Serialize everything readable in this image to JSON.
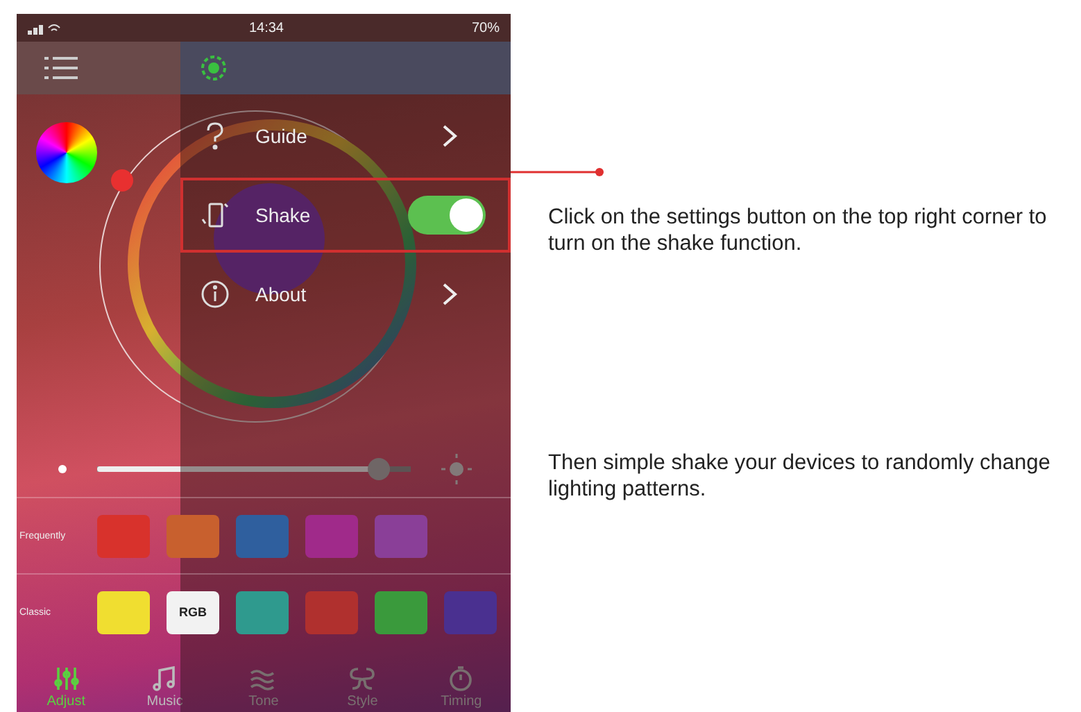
{
  "status_bar": {
    "time": "14:34",
    "battery": "70%"
  },
  "menu": [
    {
      "kind": "link",
      "label": "Guide",
      "highlighted": false
    },
    {
      "kind": "toggle",
      "label": "Shake",
      "on": true,
      "highlighted": true
    },
    {
      "kind": "link",
      "label": "About",
      "highlighted": false
    }
  ],
  "brightness": {
    "level": 0.9
  },
  "presets": [
    {
      "label": "Frequently",
      "swatches": [
        {
          "color": "#d8322c"
        },
        {
          "color": "#c8602e"
        },
        {
          "color": "#2f5f9e"
        },
        {
          "color": "#a02a8a"
        },
        {
          "color": "#8a3f98"
        }
      ]
    },
    {
      "label": "Classic",
      "swatches": [
        {
          "color": "#f0de30"
        },
        {
          "color": "#f2f2f2",
          "label": "RGB"
        },
        {
          "color": "#2f9a8e"
        },
        {
          "color": "#b0302e"
        },
        {
          "color": "#3a9a3c"
        },
        {
          "color": "#4a3090"
        }
      ]
    }
  ],
  "tabs": [
    {
      "label": "Adjust",
      "selected": true
    },
    {
      "label": "Music",
      "selected": false
    },
    {
      "label": "Tone",
      "selected": false
    },
    {
      "label": "Style",
      "selected": false
    },
    {
      "label": "Timing",
      "selected": false
    }
  ],
  "notes": [
    "Click on the settings button on the top right corner to turn on the shake function.",
    "Then simple shake your devices to randomly change lighting patterns."
  ]
}
